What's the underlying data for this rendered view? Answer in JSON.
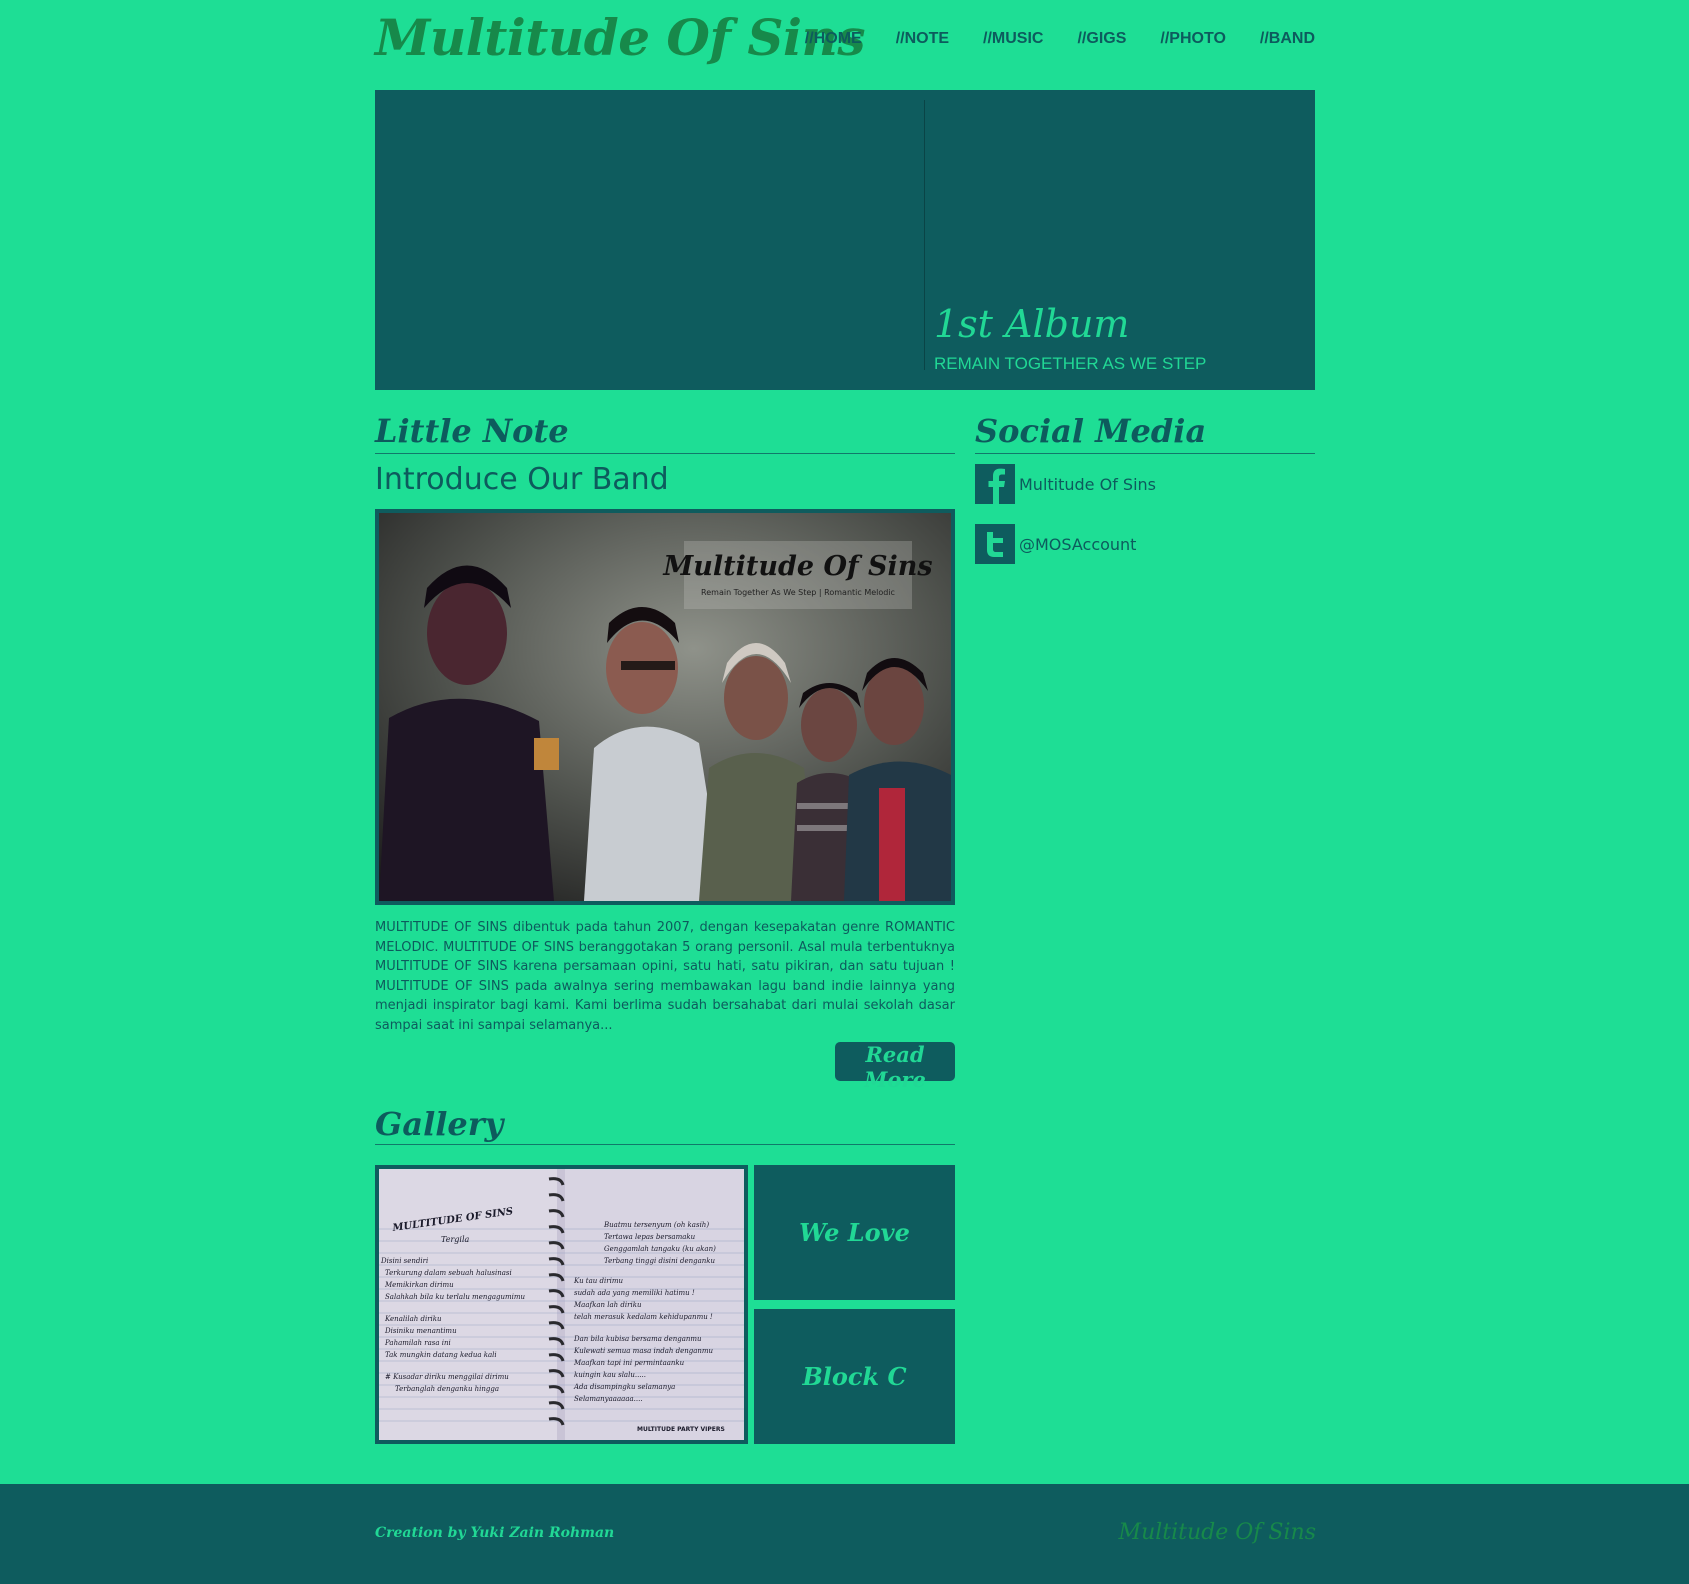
{
  "site": {
    "logo": "Multitude Of Sins"
  },
  "nav": [
    {
      "label": "//HOME"
    },
    {
      "label": "//NOTE"
    },
    {
      "label": "//MUSIC"
    },
    {
      "label": "//GIGS"
    },
    {
      "label": "//PHOTO"
    },
    {
      "label": "//BAND"
    }
  ],
  "banner": {
    "title": "1st Album",
    "subtitle": "REMAIN TOGETHER AS WE STEP"
  },
  "note": {
    "heading": "Little Note",
    "post_title": "Introduce Our Band",
    "photo_caption": "Multitude Of Sins",
    "photo_subcaption": "Remain Together As We Step  |  Romantic Melodic",
    "body": "MULTITUDE OF SINS dibentuk pada tahun 2007, dengan kesepakatan genre ROMANTIC MELODIC. MULTITUDE OF SINS beranggotakan 5 orang personil. Asal mula terbentuknya MULTITUDE OF SINS karena persamaan opini, satu hati, satu pikiran, dan satu tujuan ! MULTITUDE OF SINS pada awalnya sering membawakan lagu band indie lainnya yang menjadi inspirator bagi kami. Kami berlima sudah bersahabat dari mulai sekolah dasar sampai saat ini sampai selamanya...",
    "read_more": "Read More"
  },
  "gallery": {
    "heading": "Gallery",
    "notebook_left": {
      "heading": "MULTITUDE OF SINS",
      "subheading": "Tergila",
      "lines": [
        "Disini sendiri",
        "Terkurung dalam sebuah halusinasi",
        "Memikirkan dirimu",
        "Salahkah bila ku terlalu mengagumimu",
        "Kenalilah diriku",
        "Disiniku menantimu",
        "Pahamilah rasa ini",
        "Tak mungkin datang kedua kali",
        "#  Kusadar diriku menggilai dirimu",
        "Terbanglah denganku hingga"
      ]
    },
    "notebook_right": {
      "lines": [
        "Buatmu tersenyum (oh kasih)",
        "Tertawa lepas bersamaku",
        "Genggamlah tangaku (ku akan)",
        "Terbang tinggi disini denganku",
        "Ku tau dirimu",
        "sudah ada yang memiliki hatimu !",
        "Maafkan lah diriku",
        "telah merasuk kedalam kehidupanmu !",
        "Dan bila kubisa bersama denganmu",
        "Kulewati semua masa indah denganmu",
        "Maafkan tapi ini permintaanku",
        "kuingin kau slalu.....",
        "Ada disampingku selamanya",
        "Selamanyaaaaaa...."
      ],
      "footer": "MULTITUDE PARTY VIPERS"
    },
    "blocks": [
      {
        "label": "We Love"
      },
      {
        "label": "Block C"
      }
    ]
  },
  "social": {
    "heading": "Social Media",
    "items": [
      {
        "icon": "facebook-icon",
        "label": "Multitude Of Sins"
      },
      {
        "icon": "twitter-icon",
        "label": "@MOSAccount"
      }
    ]
  },
  "footer": {
    "credit": "Creation by Yuki Zain Rohman",
    "logo": "Multitude Of Sins"
  },
  "colors": {
    "background": "#1ede95",
    "dark": "#0e5c5e",
    "accent_text": "#21d895",
    "logo": "#17894a"
  }
}
